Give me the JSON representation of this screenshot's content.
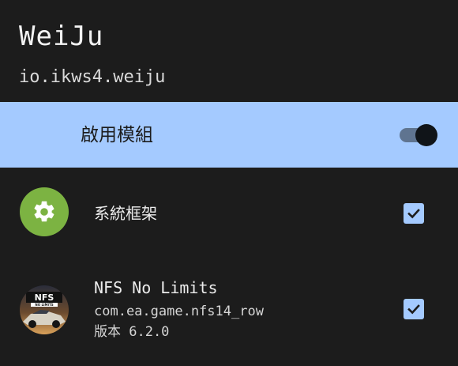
{
  "header": {
    "app_name": "WeiJu",
    "package_name": "io.ikws4.weiju"
  },
  "enable_module": {
    "label": "啟用模組",
    "enabled": true
  },
  "modules": [
    {
      "title": "系統框架",
      "icon": "android-gear-icon",
      "checked": true
    },
    {
      "title": "NFS No Limits",
      "package": "com.ea.game.nfs14_row",
      "version": "版本 6.2.0",
      "icon": "nfs-no-limits-app-icon",
      "checked": true
    }
  ],
  "colors": {
    "background": "#1c1c1c",
    "accent": "#a4caff",
    "android_green": "#7cb342"
  }
}
